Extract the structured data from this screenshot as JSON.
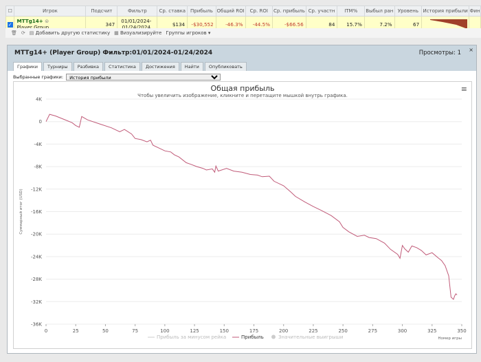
{
  "table": {
    "columns": [
      "Игрок",
      "Подсчит",
      "Фильтр",
      "Ср. ставка",
      "Прибыль",
      "Общий ROI",
      "Ср. ROI",
      "Ср. прибыль",
      "Ср. участн",
      "ITM%",
      "Выбыл ран",
      "Уровень",
      "История прибыли",
      "Фин"
    ],
    "row": {
      "player_name": "MTTg14+",
      "player_group": "Player Group",
      "count": "347",
      "filter_line1": "01/01/2024-",
      "filter_line2": "01/24/2024",
      "avg_stake": "$134",
      "profit": "-$30,552",
      "total_roi": "-46.3%",
      "avg_roi": "-44.5%",
      "avg_profit": "-$66.56",
      "avg_entrants": "84",
      "itm": "15.7%",
      "early_out": "7.2%",
      "level": "67"
    }
  },
  "toolbar": {
    "add_stats": "Добавить другую статистику",
    "visualize": "Визуализируйте",
    "groups": "Группы игроков"
  },
  "panel": {
    "title": "MTTg14+ (Player Group) Фильтр:01/01/2024-01/24/2024",
    "views": "Просмотры: 1",
    "tabs": [
      "Графики",
      "Турниры",
      "Разбивка",
      "Статистика",
      "Достижения",
      "Найти",
      "Опубликовать"
    ],
    "selected_label": "Выбранные графики:",
    "selected_value": "История прибыли",
    "close": "×",
    "menu": "≡"
  },
  "chart_data": {
    "type": "line",
    "title": "Общая прибыль",
    "subtitle": "Чтобы увеличить изображение, кликните и перетащите мышкой внутрь графика.",
    "xlabel": "Номер игры",
    "ylabel": "Суммарный итог (USD)",
    "xlim": [
      0,
      350
    ],
    "ylim": [
      -36000,
      4000
    ],
    "x_ticks": [
      "0",
      "25",
      "50",
      "75",
      "100",
      "125",
      "150",
      "175",
      "200",
      "225",
      "250",
      "275",
      "300",
      "325",
      "350"
    ],
    "y_ticks": [
      "4K",
      "0",
      "-4K",
      "-8K",
      "-12K",
      "-16K",
      "-20K",
      "-24K",
      "-28K",
      "-32K",
      "-36K"
    ],
    "legend": [
      "Прибыль за минусом рейка",
      "Прибыль",
      "Значительные выигрыши"
    ],
    "series": [
      {
        "name": "Прибыль",
        "color": "#c05a78",
        "points": [
          [
            0,
            0
          ],
          [
            3,
            1300
          ],
          [
            8,
            1000
          ],
          [
            15,
            400
          ],
          [
            22,
            -200
          ],
          [
            25,
            -700
          ],
          [
            28,
            -1000
          ],
          [
            30,
            900
          ],
          [
            35,
            300
          ],
          [
            45,
            -400
          ],
          [
            55,
            -1100
          ],
          [
            62,
            -1800
          ],
          [
            66,
            -1400
          ],
          [
            72,
            -2200
          ],
          [
            75,
            -3000
          ],
          [
            80,
            -3200
          ],
          [
            85,
            -3600
          ],
          [
            88,
            -3300
          ],
          [
            90,
            -4200
          ],
          [
            95,
            -4700
          ],
          [
            100,
            -5200
          ],
          [
            105,
            -5400
          ],
          [
            108,
            -5900
          ],
          [
            112,
            -6300
          ],
          [
            118,
            -7300
          ],
          [
            122,
            -7600
          ],
          [
            127,
            -8000
          ],
          [
            132,
            -8300
          ],
          [
            135,
            -8600
          ],
          [
            140,
            -8400
          ],
          [
            142,
            -9000
          ],
          [
            143,
            -7900
          ],
          [
            145,
            -8800
          ],
          [
            152,
            -8300
          ],
          [
            158,
            -8800
          ],
          [
            165,
            -9000
          ],
          [
            172,
            -9400
          ],
          [
            178,
            -9500
          ],
          [
            182,
            -9800
          ],
          [
            188,
            -9700
          ],
          [
            192,
            -10600
          ],
          [
            200,
            -11400
          ],
          [
            206,
            -12500
          ],
          [
            210,
            -13300
          ],
          [
            218,
            -14300
          ],
          [
            225,
            -15100
          ],
          [
            232,
            -15800
          ],
          [
            240,
            -16700
          ],
          [
            247,
            -17800
          ],
          [
            250,
            -18800
          ],
          [
            255,
            -19600
          ],
          [
            262,
            -20400
          ],
          [
            268,
            -20200
          ],
          [
            272,
            -20600
          ],
          [
            278,
            -20800
          ],
          [
            285,
            -21600
          ],
          [
            290,
            -22700
          ],
          [
            296,
            -23600
          ],
          [
            298,
            -24300
          ],
          [
            300,
            -22000
          ],
          [
            302,
            -22600
          ],
          [
            305,
            -23200
          ],
          [
            308,
            -22100
          ],
          [
            312,
            -22400
          ],
          [
            316,
            -22900
          ],
          [
            320,
            -23700
          ],
          [
            325,
            -23300
          ],
          [
            330,
            -24200
          ],
          [
            333,
            -24700
          ],
          [
            336,
            -25600
          ],
          [
            339,
            -27400
          ],
          [
            341,
            -31200
          ],
          [
            343,
            -31600
          ],
          [
            344,
            -31000
          ],
          [
            345,
            -30600
          ],
          [
            346,
            -30800
          ]
        ]
      }
    ]
  }
}
